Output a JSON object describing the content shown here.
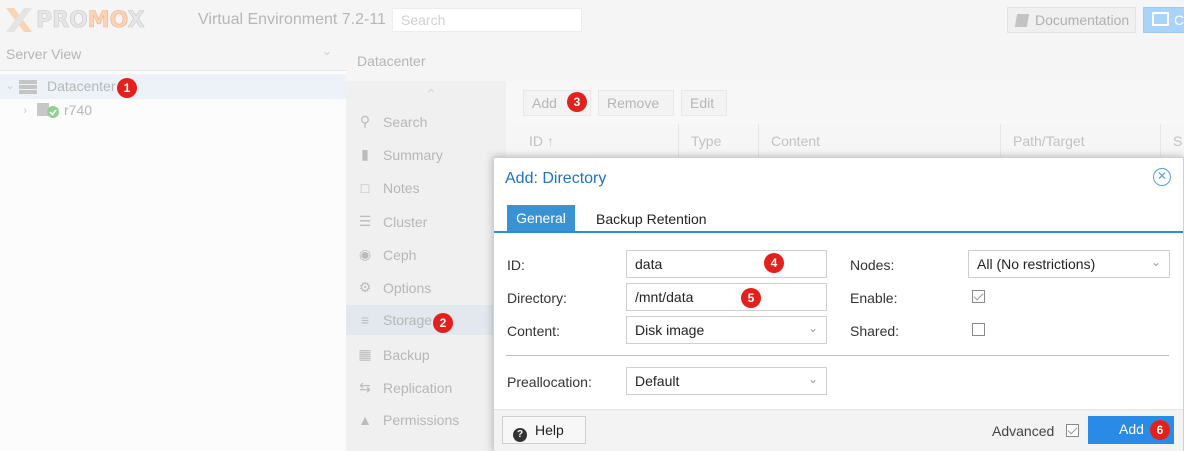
{
  "topbar": {
    "logo_text_a": "PRO",
    "logo_text_b": "MO",
    "logo_text_c": "X",
    "product": "Virtual Environment 7.2-11",
    "search_placeholder": "Search",
    "documentation": "Documentation",
    "create_vm": "Cr"
  },
  "server_view": {
    "title": "Server View",
    "tree": [
      {
        "label": "Datacenter",
        "icon": "datacenter-icon"
      },
      {
        "label": "r740",
        "icon": "node-online-icon"
      }
    ]
  },
  "datacenter": {
    "title": "Datacenter",
    "menu": [
      {
        "label": "Search",
        "icon": "search-icon"
      },
      {
        "label": "Summary",
        "icon": "book-icon"
      },
      {
        "label": "Notes",
        "icon": "notes-icon"
      },
      {
        "label": "Cluster",
        "icon": "server-icon"
      },
      {
        "label": "Ceph",
        "icon": "ceph-icon"
      },
      {
        "label": "Options",
        "icon": "gear-icon"
      },
      {
        "label": "Storage",
        "icon": "database-icon"
      },
      {
        "label": "Backup",
        "icon": "floppy-icon"
      },
      {
        "label": "Replication",
        "icon": "retweet-icon"
      },
      {
        "label": "Permissions",
        "icon": "unlock-icon"
      }
    ],
    "toolbar": {
      "add": "Add",
      "remove": "Remove",
      "edit": "Edit"
    },
    "grid_columns": [
      "ID ↑",
      "Type",
      "Content",
      "Path/Target",
      "S"
    ]
  },
  "dialog": {
    "title": "Add: Directory",
    "tabs": [
      "General",
      "Backup Retention"
    ],
    "fields": {
      "id_label": "ID:",
      "id_value": "data",
      "directory_label": "Directory:",
      "directory_value": "/mnt/data",
      "content_label": "Content:",
      "content_value": "Disk image",
      "nodes_label": "Nodes:",
      "nodes_value": "All (No restrictions)",
      "enable_label": "Enable:",
      "enable_checked": true,
      "shared_label": "Shared:",
      "shared_checked": false,
      "prealloc_label": "Preallocation:",
      "prealloc_value": "Default"
    },
    "footer": {
      "help": "Help",
      "advanced": "Advanced",
      "advanced_checked": true,
      "add": "Add"
    }
  },
  "markers": [
    "1",
    "2",
    "3",
    "4",
    "5",
    "6"
  ],
  "colors": {
    "accent": "#3892d4",
    "marker": "#e3201b",
    "title_blue": "#1c74c2"
  }
}
